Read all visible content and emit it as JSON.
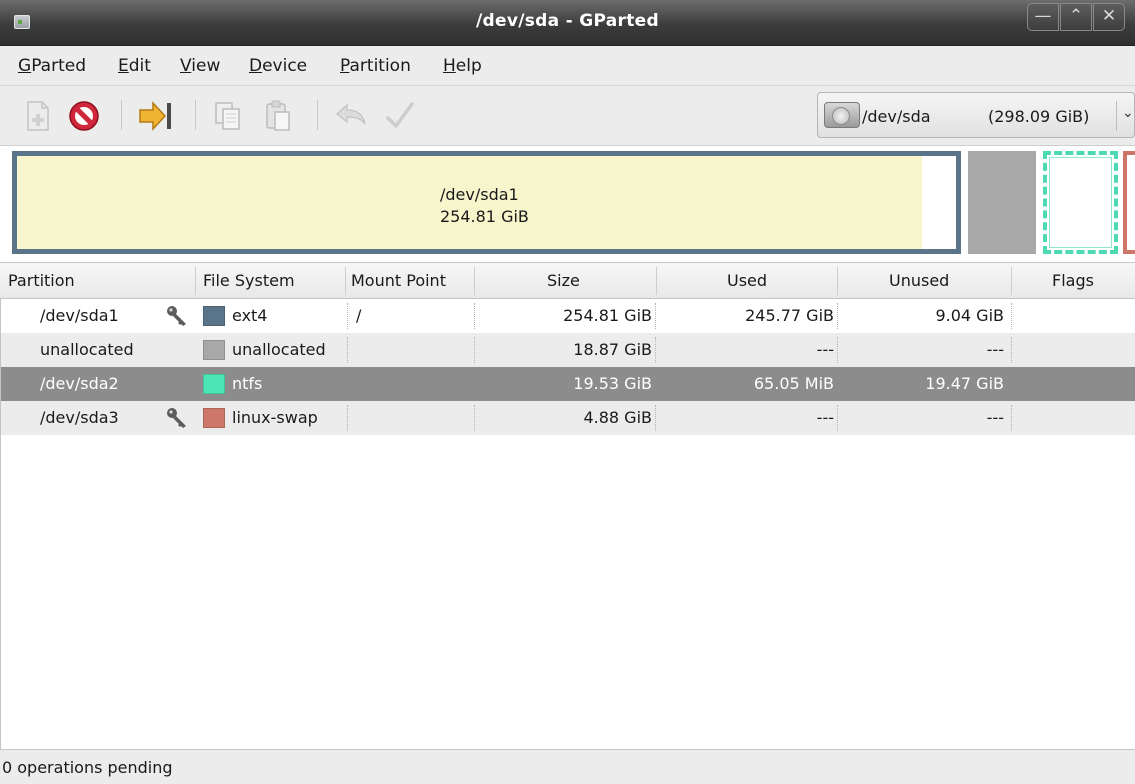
{
  "window": {
    "title": "/dev/sda - GParted",
    "controls": [
      "minimize",
      "maximize",
      "close"
    ]
  },
  "menu": [
    {
      "label": "GParted",
      "accel": "G",
      "rest": "Parted"
    },
    {
      "label": "Edit",
      "accel": "E",
      "rest": "dit"
    },
    {
      "label": "View",
      "accel": "V",
      "rest": "iew"
    },
    {
      "label": "Device",
      "accel": "D",
      "rest": "evice"
    },
    {
      "label": "Partition",
      "accel": "P",
      "rest": "artition"
    },
    {
      "label": "Help",
      "accel": "H",
      "rest": "elp"
    }
  ],
  "toolbar": {
    "buttons": [
      "new-partition",
      "delete-partition",
      "resize-move",
      "copy",
      "paste",
      "undo",
      "apply"
    ],
    "enabled": {
      "new-partition": false,
      "delete-partition": true,
      "resize-move": true,
      "copy": false,
      "paste": false,
      "undo": false,
      "apply": false
    }
  },
  "device": {
    "name": "/dev/sda",
    "size": "(298.09 GiB)"
  },
  "diskmap": {
    "sda1_label": "/dev/sda1",
    "sda1_size": "254.81 GiB",
    "sda1_used_fraction": 0.964
  },
  "columns": {
    "partition": "Partition",
    "filesystem": "File System",
    "mountpoint": "Mount Point",
    "size": "Size",
    "used": "Used",
    "unused": "Unused",
    "flags": "Flags"
  },
  "rows": [
    {
      "partition": "/dev/sda1",
      "locked": true,
      "fs": "ext4",
      "fs_color": "#5a7489",
      "mount": "/",
      "size": "254.81 GiB",
      "used": "245.77 GiB",
      "unused": "9.04 GiB",
      "flags": ""
    },
    {
      "partition": "unallocated",
      "locked": false,
      "fs": "unallocated",
      "fs_color": "#a8a8a8",
      "mount": "",
      "size": "18.87 GiB",
      "used": "---",
      "unused": "---",
      "flags": ""
    },
    {
      "partition": "/dev/sda2",
      "locked": false,
      "fs": "ntfs",
      "fs_color": "#4de6b6",
      "mount": "",
      "size": "19.53 GiB",
      "used": "65.05 MiB",
      "unused": "19.47 GiB",
      "flags": "",
      "selected": true
    },
    {
      "partition": "/dev/sda3",
      "locked": true,
      "fs": "linux-swap",
      "fs_color": "#cc776a",
      "mount": "",
      "size": "4.88 GiB",
      "used": "---",
      "unused": "---",
      "flags": ""
    }
  ],
  "status": "0 operations pending"
}
